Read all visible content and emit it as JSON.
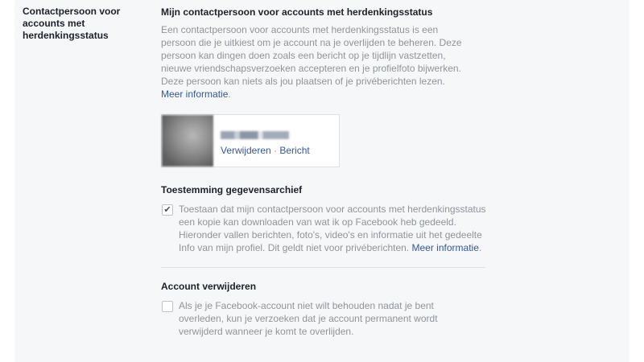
{
  "sidebar": {
    "label": "Contactpersoon voor accounts met herdenkingsstatus"
  },
  "legacy": {
    "title": "Mijn contactpersoon voor accounts met herdenkingsstatus",
    "description": "Een contactpersoon voor accounts met herdenkingsstatus is een persoon die je uitkiest om je account na je overlijden te beheren. Deze persoon kan dingen doen zoals een bericht op je tijdlijn vastzetten, nieuwe vriendschapsverzoeken accepteren en je profielfoto bijwerken. Deze persoon kan niets als jou plaatsen of je privéberichten lezen.",
    "more_link": "Meer informatie",
    "contact": {
      "remove_label": "Verwijderen",
      "separator": " · ",
      "message_label": "Bericht"
    }
  },
  "archive": {
    "heading": "Toestemming gegevensarchief",
    "checked": true,
    "check_mark": "✔",
    "text": "Toestaan dat mijn contactpersoon voor accounts met herdenkingsstatus een kopie kan downloaden van wat ik op Facebook heb gedeeld. Hieronder vallen berichten, foto's, video's en informatie uit het gedeelte Info van mijn profiel. Dit geldt niet voor privéberichten.",
    "more_link": "Meer informatie",
    "trailing": "."
  },
  "delete_account": {
    "heading": "Account verwijderen",
    "checked": false,
    "text": "Als je je Facebook-account niet wilt behouden nadat je bent overleden, kun je verzoeken dat je account permanent wordt verwijderd wanneer je komt te overlijden."
  },
  "colors": {
    "panel_bg": "#f6f7f9",
    "link": "#365899",
    "muted_text": "#90949c",
    "heading_text": "#1d2129"
  }
}
